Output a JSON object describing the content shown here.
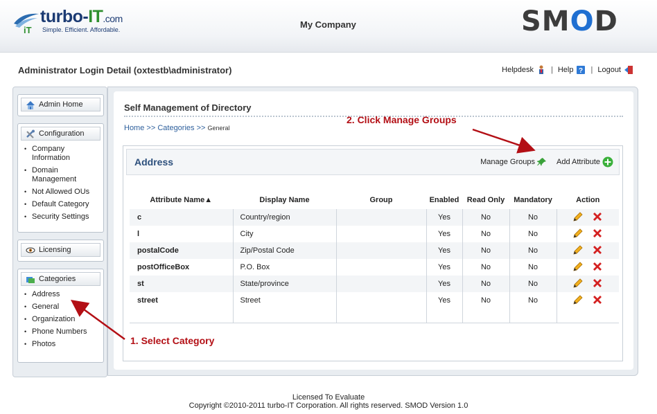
{
  "header": {
    "logo_brand_prefix": "turbo-",
    "logo_brand_it": "IT",
    "logo_brand_domain": ".com",
    "logo_tagline": "Simple.  Efficient.  Affordable.",
    "company": "My Company",
    "product_logo": "SMOD"
  },
  "subbar": {
    "admin_detail": "Administrator Login Detail (oxtestb\\administrator)",
    "helpdesk": "Helpdesk",
    "help": "Help",
    "logout": "Logout"
  },
  "sidebar": {
    "admin_home": "Admin Home",
    "configuration": {
      "title": "Configuration",
      "items": [
        "Company Information",
        "Domain Management",
        "Not Allowed OUs",
        "Default Category",
        "Security Settings"
      ]
    },
    "licensing": "Licensing",
    "categories": {
      "title": "Categories",
      "items": [
        "Address",
        "General",
        "Organization",
        "Phone Numbers",
        "Photos"
      ]
    }
  },
  "main": {
    "title": "Self Management of Directory",
    "breadcrumb": {
      "home": "Home",
      "sep": ">>",
      "categories": "Categories",
      "current": "General"
    },
    "card": {
      "title": "Address",
      "manage_groups": "Manage Groups",
      "add_attribute": "Add Attribute"
    },
    "table": {
      "columns": [
        "Attribute Name▲",
        "Display Name",
        "Group",
        "Enabled",
        "Read Only",
        "Mandatory",
        "Action"
      ],
      "rows": [
        {
          "name": "c",
          "display": "Country/region",
          "group": "",
          "enabled": "Yes",
          "readonly": "No",
          "mandatory": "No"
        },
        {
          "name": "l",
          "display": "City",
          "group": "",
          "enabled": "Yes",
          "readonly": "No",
          "mandatory": "No"
        },
        {
          "name": "postalCode",
          "display": "Zip/Postal Code",
          "group": "",
          "enabled": "Yes",
          "readonly": "No",
          "mandatory": "No"
        },
        {
          "name": "postOfficeBox",
          "display": "P.O. Box",
          "group": "",
          "enabled": "Yes",
          "readonly": "No",
          "mandatory": "No"
        },
        {
          "name": "st",
          "display": "State/province",
          "group": "",
          "enabled": "Yes",
          "readonly": "No",
          "mandatory": "No"
        },
        {
          "name": "street",
          "display": "Street",
          "group": "",
          "enabled": "Yes",
          "readonly": "No",
          "mandatory": "No"
        }
      ]
    }
  },
  "annotations": {
    "step1": "1.  Select Category",
    "step2": "2.  Click Manage Groups"
  },
  "footer": {
    "line1": "Licensed To Evaluate",
    "line2": "Copyright ©2010-2011 turbo-IT Corporation. All rights reserved. SMOD Version 1.0"
  },
  "colors": {
    "accent_blue": "#2c4f7c",
    "attr_green": "#2e7d32",
    "annotation_red": "#b30f15"
  },
  "icons": {
    "admin_home": "house-icon",
    "configuration": "tools-icon",
    "licensing": "eye-icon",
    "categories": "folders-icon",
    "manage_groups": "pushpin-icon",
    "add_attribute": "plus-circle-icon",
    "edit": "pencil-icon",
    "delete": "x-icon"
  }
}
